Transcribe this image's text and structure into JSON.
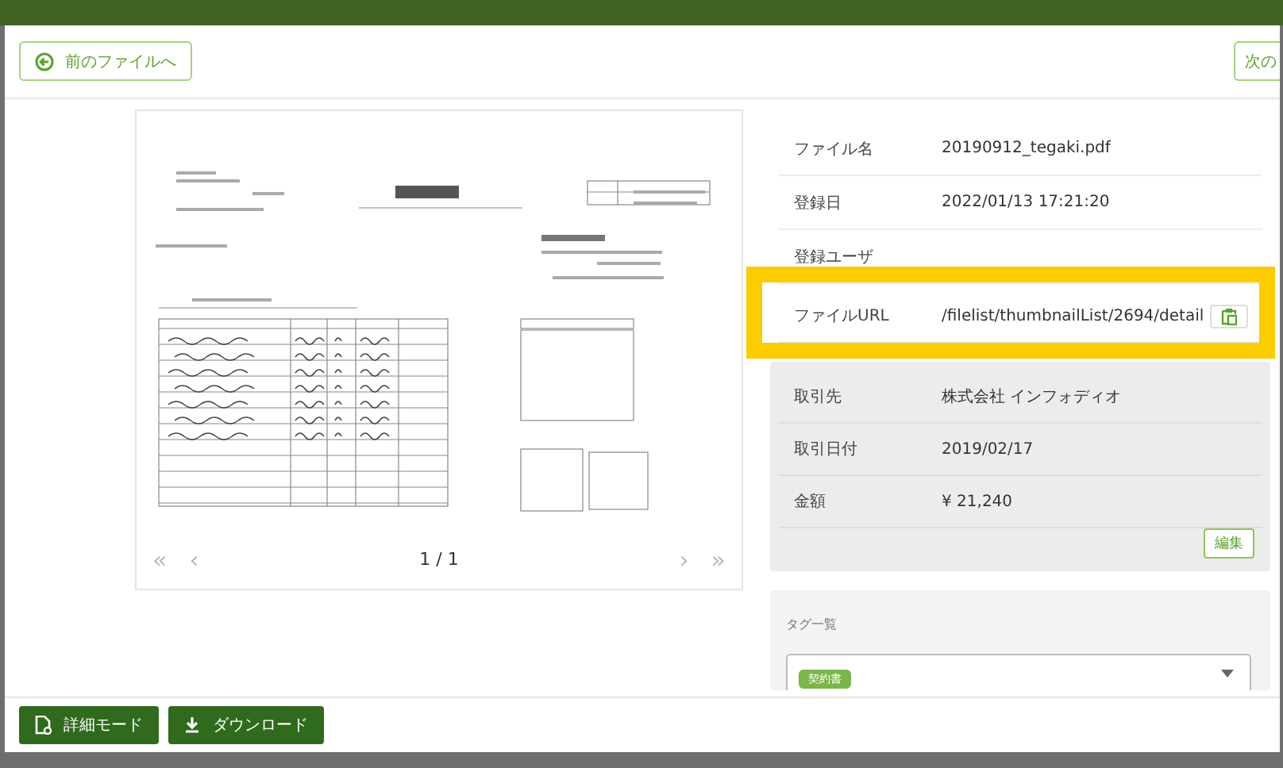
{
  "navigation": {
    "previous": {
      "label": "前のファイルへ"
    },
    "next": {
      "label": "次の"
    }
  },
  "preview": {
    "pager": {
      "first": "«",
      "prev": "‹",
      "page": "1 / 1",
      "next": "›",
      "last": "»"
    }
  },
  "file_info": [
    {
      "label": "ファイル名",
      "value": "20190912_tegaki.pdf",
      "kind": "text",
      "highlighted": false
    },
    {
      "label": "登録日",
      "value": "2022/01/13 17:21:20",
      "kind": "text",
      "highlighted": false
    },
    {
      "label": "登録ユーザ",
      "highlighted": false
    },
    {
      "label": "ファイルURL",
      "value": "/filelist/thumbnailList/2694/detail",
      "kind": "url",
      "highlighted": true
    }
  ],
  "transaction": {
    "fields": [
      {
        "label": "取引先",
        "value": "株式会社 インフォディオ"
      },
      {
        "label": "取引日付",
        "value": "2019/02/17"
      },
      {
        "label": "金額",
        "value": "¥ 21,240"
      }
    ],
    "edit_button": "編集"
  },
  "tags": {
    "title": "タグ一覧",
    "chips": [
      {
        "label": "契約書"
      }
    ]
  },
  "footer_buttons": [
    {
      "label": "詳細モード",
      "kind": "detail"
    },
    {
      "label": "ダウンロード",
      "kind": "download"
    }
  ]
}
